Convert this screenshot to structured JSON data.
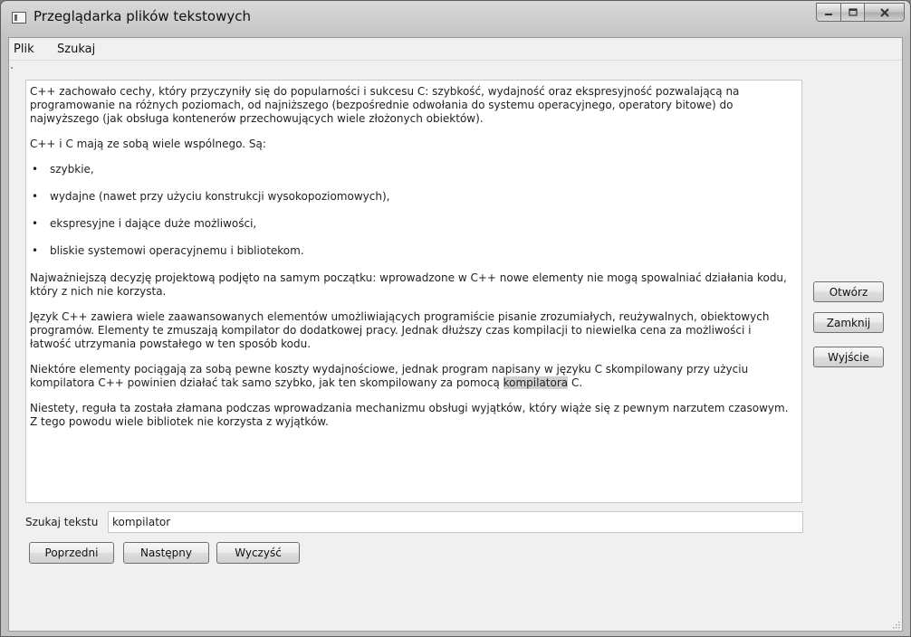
{
  "window": {
    "title": "Przeglądarka plików tekstowych",
    "controls": {
      "minimize_icon": "minimize-icon",
      "maximize_icon": "maximize-icon",
      "close_icon": "close-icon"
    }
  },
  "menu": {
    "items": [
      {
        "label": "Plik"
      },
      {
        "label": "Szukaj"
      }
    ]
  },
  "document": {
    "p1": "C++ zachowało cechy, który przyczyniły się do popularności i sukcesu C: szybkość, wydajność oraz ekspresyjność pozwalającą na programowanie na różnych poziomach, od najniższego (bezpośrednie odwołania do systemu operacyjnego, operatory bitowe) do najwyższego (jak obsługa kontenerów przechowujących wiele złożonych obiektów).",
    "p2": "C++ i C mają ze sobą wiele wspólnego. Są:",
    "bullet_char": "•",
    "bullets": [
      "szybkie,",
      "wydajne (nawet przy użyciu konstrukcji wysokopoziomowych),",
      "ekspresyjne i dające duże możliwości,",
      "bliskie systemowi operacyjnemu i bibliotekom."
    ],
    "p3": "Najważniejszą decyzję projektową podjęto na samym początku: wprowadzone w C++ nowe elementy nie mogą spowalniać działania kodu, który z nich nie korzysta.",
    "p4": "Język C++ zawiera wiele zaawansowanych elementów umożliwiających programiście pisanie zrozumiałych, reużywalnych, obiektowych programów. Elementy te zmuszają kompilator do dodatkowej pracy. Jednak dłuższy czas kompilacji to niewielka cena za możliwości i łatwość utrzymania powstałego w ten sposób kodu.",
    "p5_before": "Niektóre elementy pociągają za sobą pewne koszty wydajnościowe, jednak program napisany w języku C skompilowany przy użyciu kompilatora C++ powinien działać tak samo szybko, jak ten skompilowany za pomocą ",
    "p5_highlight": "kompilatora",
    "p5_after": " C.",
    "p6": "Niestety, reguła ta została złamana podczas wprowadzania mechanizmu obsługi wyjątków, który wiąże się z pewnym narzutem czasowym. Z tego powodu wiele bibliotek nie korzysta z wyjątków."
  },
  "side_buttons": {
    "open": "Otwórz",
    "close": "Zamknij",
    "exit": "Wyjście"
  },
  "search": {
    "label": "Szukaj tekstu",
    "value": "kompilator",
    "prev": "Poprzedni",
    "next": "Następny",
    "clear": "Wyczyść"
  },
  "colors": {
    "highlight": "#d0d0d0",
    "window_bg": "#f0f0f0"
  }
}
